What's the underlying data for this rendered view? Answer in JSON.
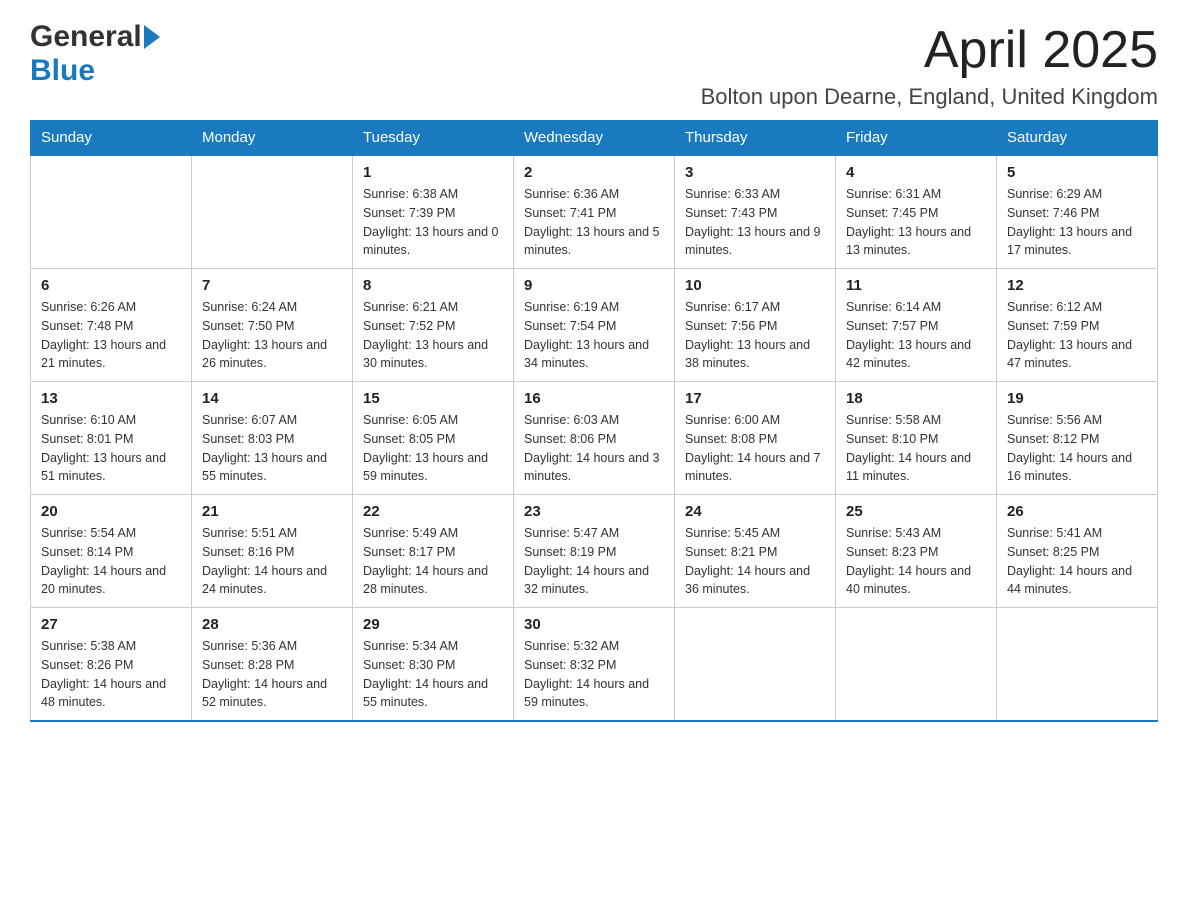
{
  "header": {
    "logo_general": "General",
    "logo_blue": "Blue",
    "month_title": "April 2025",
    "location": "Bolton upon Dearne, England, United Kingdom"
  },
  "weekdays": [
    "Sunday",
    "Monday",
    "Tuesday",
    "Wednesday",
    "Thursday",
    "Friday",
    "Saturday"
  ],
  "weeks": [
    [
      {
        "day": "",
        "sunrise": "",
        "sunset": "",
        "daylight": ""
      },
      {
        "day": "",
        "sunrise": "",
        "sunset": "",
        "daylight": ""
      },
      {
        "day": "1",
        "sunrise": "Sunrise: 6:38 AM",
        "sunset": "Sunset: 7:39 PM",
        "daylight": "Daylight: 13 hours and 0 minutes."
      },
      {
        "day": "2",
        "sunrise": "Sunrise: 6:36 AM",
        "sunset": "Sunset: 7:41 PM",
        "daylight": "Daylight: 13 hours and 5 minutes."
      },
      {
        "day": "3",
        "sunrise": "Sunrise: 6:33 AM",
        "sunset": "Sunset: 7:43 PM",
        "daylight": "Daylight: 13 hours and 9 minutes."
      },
      {
        "day": "4",
        "sunrise": "Sunrise: 6:31 AM",
        "sunset": "Sunset: 7:45 PM",
        "daylight": "Daylight: 13 hours and 13 minutes."
      },
      {
        "day": "5",
        "sunrise": "Sunrise: 6:29 AM",
        "sunset": "Sunset: 7:46 PM",
        "daylight": "Daylight: 13 hours and 17 minutes."
      }
    ],
    [
      {
        "day": "6",
        "sunrise": "Sunrise: 6:26 AM",
        "sunset": "Sunset: 7:48 PM",
        "daylight": "Daylight: 13 hours and 21 minutes."
      },
      {
        "day": "7",
        "sunrise": "Sunrise: 6:24 AM",
        "sunset": "Sunset: 7:50 PM",
        "daylight": "Daylight: 13 hours and 26 minutes."
      },
      {
        "day": "8",
        "sunrise": "Sunrise: 6:21 AM",
        "sunset": "Sunset: 7:52 PM",
        "daylight": "Daylight: 13 hours and 30 minutes."
      },
      {
        "day": "9",
        "sunrise": "Sunrise: 6:19 AM",
        "sunset": "Sunset: 7:54 PM",
        "daylight": "Daylight: 13 hours and 34 minutes."
      },
      {
        "day": "10",
        "sunrise": "Sunrise: 6:17 AM",
        "sunset": "Sunset: 7:56 PM",
        "daylight": "Daylight: 13 hours and 38 minutes."
      },
      {
        "day": "11",
        "sunrise": "Sunrise: 6:14 AM",
        "sunset": "Sunset: 7:57 PM",
        "daylight": "Daylight: 13 hours and 42 minutes."
      },
      {
        "day": "12",
        "sunrise": "Sunrise: 6:12 AM",
        "sunset": "Sunset: 7:59 PM",
        "daylight": "Daylight: 13 hours and 47 minutes."
      }
    ],
    [
      {
        "day": "13",
        "sunrise": "Sunrise: 6:10 AM",
        "sunset": "Sunset: 8:01 PM",
        "daylight": "Daylight: 13 hours and 51 minutes."
      },
      {
        "day": "14",
        "sunrise": "Sunrise: 6:07 AM",
        "sunset": "Sunset: 8:03 PM",
        "daylight": "Daylight: 13 hours and 55 minutes."
      },
      {
        "day": "15",
        "sunrise": "Sunrise: 6:05 AM",
        "sunset": "Sunset: 8:05 PM",
        "daylight": "Daylight: 13 hours and 59 minutes."
      },
      {
        "day": "16",
        "sunrise": "Sunrise: 6:03 AM",
        "sunset": "Sunset: 8:06 PM",
        "daylight": "Daylight: 14 hours and 3 minutes."
      },
      {
        "day": "17",
        "sunrise": "Sunrise: 6:00 AM",
        "sunset": "Sunset: 8:08 PM",
        "daylight": "Daylight: 14 hours and 7 minutes."
      },
      {
        "day": "18",
        "sunrise": "Sunrise: 5:58 AM",
        "sunset": "Sunset: 8:10 PM",
        "daylight": "Daylight: 14 hours and 11 minutes."
      },
      {
        "day": "19",
        "sunrise": "Sunrise: 5:56 AM",
        "sunset": "Sunset: 8:12 PM",
        "daylight": "Daylight: 14 hours and 16 minutes."
      }
    ],
    [
      {
        "day": "20",
        "sunrise": "Sunrise: 5:54 AM",
        "sunset": "Sunset: 8:14 PM",
        "daylight": "Daylight: 14 hours and 20 minutes."
      },
      {
        "day": "21",
        "sunrise": "Sunrise: 5:51 AM",
        "sunset": "Sunset: 8:16 PM",
        "daylight": "Daylight: 14 hours and 24 minutes."
      },
      {
        "day": "22",
        "sunrise": "Sunrise: 5:49 AM",
        "sunset": "Sunset: 8:17 PM",
        "daylight": "Daylight: 14 hours and 28 minutes."
      },
      {
        "day": "23",
        "sunrise": "Sunrise: 5:47 AM",
        "sunset": "Sunset: 8:19 PM",
        "daylight": "Daylight: 14 hours and 32 minutes."
      },
      {
        "day": "24",
        "sunrise": "Sunrise: 5:45 AM",
        "sunset": "Sunset: 8:21 PM",
        "daylight": "Daylight: 14 hours and 36 minutes."
      },
      {
        "day": "25",
        "sunrise": "Sunrise: 5:43 AM",
        "sunset": "Sunset: 8:23 PM",
        "daylight": "Daylight: 14 hours and 40 minutes."
      },
      {
        "day": "26",
        "sunrise": "Sunrise: 5:41 AM",
        "sunset": "Sunset: 8:25 PM",
        "daylight": "Daylight: 14 hours and 44 minutes."
      }
    ],
    [
      {
        "day": "27",
        "sunrise": "Sunrise: 5:38 AM",
        "sunset": "Sunset: 8:26 PM",
        "daylight": "Daylight: 14 hours and 48 minutes."
      },
      {
        "day": "28",
        "sunrise": "Sunrise: 5:36 AM",
        "sunset": "Sunset: 8:28 PM",
        "daylight": "Daylight: 14 hours and 52 minutes."
      },
      {
        "day": "29",
        "sunrise": "Sunrise: 5:34 AM",
        "sunset": "Sunset: 8:30 PM",
        "daylight": "Daylight: 14 hours and 55 minutes."
      },
      {
        "day": "30",
        "sunrise": "Sunrise: 5:32 AM",
        "sunset": "Sunset: 8:32 PM",
        "daylight": "Daylight: 14 hours and 59 minutes."
      },
      {
        "day": "",
        "sunrise": "",
        "sunset": "",
        "daylight": ""
      },
      {
        "day": "",
        "sunrise": "",
        "sunset": "",
        "daylight": ""
      },
      {
        "day": "",
        "sunrise": "",
        "sunset": "",
        "daylight": ""
      }
    ]
  ]
}
